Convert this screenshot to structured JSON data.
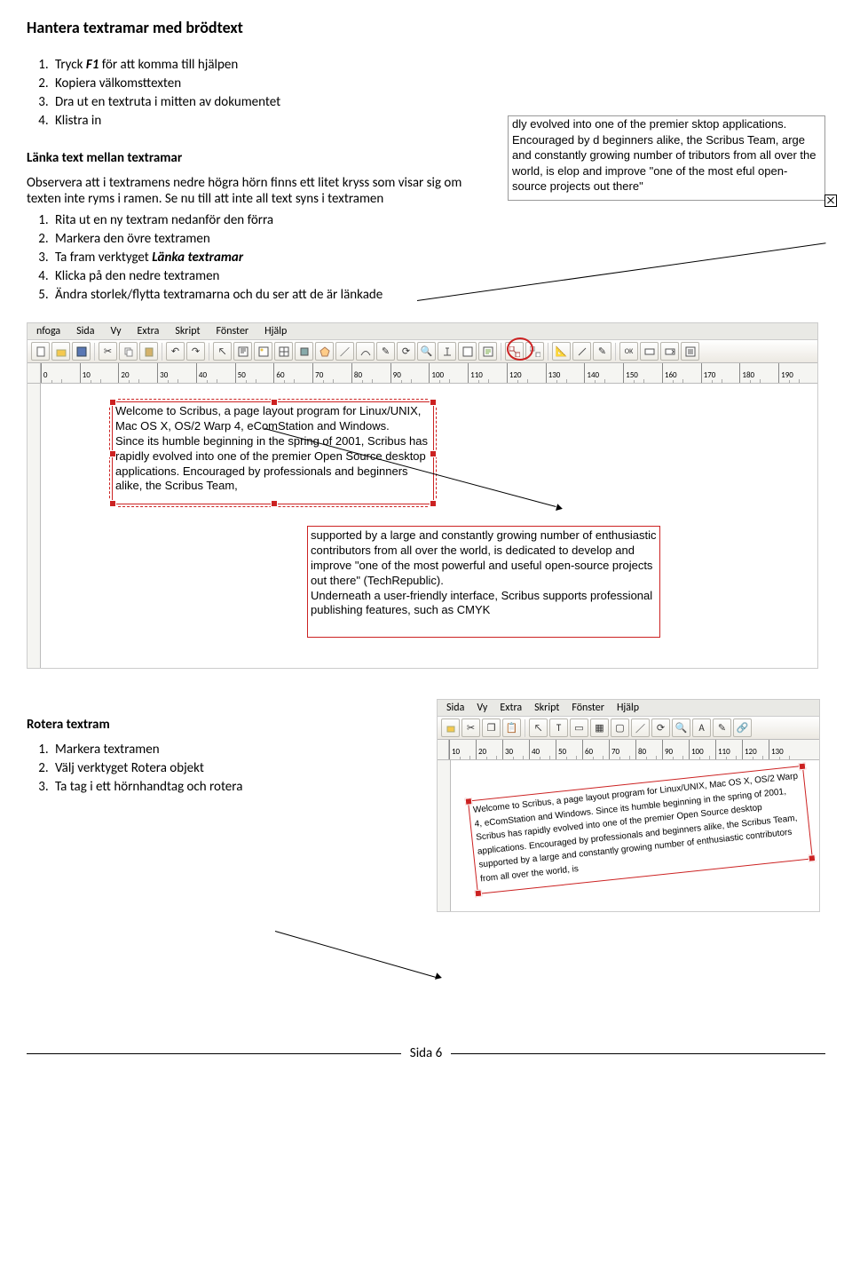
{
  "title": "Hantera textramar med brödtext",
  "section1": {
    "items": [
      {
        "pre": "Tryck ",
        "bold": "F1",
        "post": " för att komma till hjälpen"
      },
      {
        "pre": "Kopiera välkomsttexten"
      },
      {
        "pre": "Dra ut en textruta i mitten av dokumentet"
      },
      {
        "pre": "Klistra in"
      }
    ]
  },
  "link_heading": "Länka text mellan textramar",
  "link_para": "Observera att i textramens nedre högra hörn finns ett litet kryss som visar sig om texten inte ryms i ramen. Se nu till att inte all text syns i textramen",
  "overflow_text": "dly evolved into one of the premier sktop applications. Encouraged by d beginners alike, the Scribus Team, arge and constantly growing number of tributors from all over the world, is elop and improve \"one of the most eful open-source projects out there\"",
  "section2": {
    "items": [
      "Rita ut en ny textram nedanför den förra",
      "Markera den övre textramen",
      {
        "pre": "Ta fram verktyget ",
        "boldital": "Länka textramar"
      },
      "Klicka på den nedre textramen",
      "Ändra storlek/flytta textramarna och du ser att de är länkade"
    ]
  },
  "scribus1": {
    "menus": [
      "nfoga",
      "Sida",
      "Vy",
      "Extra",
      "Skript",
      "Fönster",
      "Hjälp"
    ],
    "ruler_labels": [
      "0",
      "10",
      "20",
      "30",
      "40",
      "50",
      "60",
      "70",
      "80",
      "90",
      "100",
      "110",
      "120",
      "130",
      "140",
      "150",
      "160",
      "170",
      "180",
      "190"
    ],
    "frame1_text": "Welcome to Scribus, a page layout program for Linux/UNIX, Mac OS X, OS/2 Warp 4, eComStation and Windows.\nSince its humble beginning in the spring of 2001, Scribus has rapidly evolved into one of the premier Open Source desktop applications. Encouraged by professionals and beginners alike, the Scribus Team,",
    "frame2_text": "supported by a large and constantly growing number of enthusiastic contributors from all over the world, is dedicated to develop and improve \"one of the most powerful and useful open-source projects out there\" (TechRepublic).\nUnderneath a user-friendly interface, Scribus supports professional publishing features, such as CMYK"
  },
  "rotera_heading": "Rotera textram",
  "rotera_items": [
    "Markera textramen",
    "Välj verktyget Rotera objekt",
    "Ta tag i ett hörnhandtag och rotera"
  ],
  "scribus2": {
    "menus": [
      "Sida",
      "Vy",
      "Extra",
      "Skript",
      "Fönster",
      "Hjälp"
    ],
    "ruler_labels": [
      "10",
      "20",
      "30",
      "40",
      "50",
      "60",
      "70",
      "80",
      "90",
      "100",
      "110",
      "120",
      "130"
    ],
    "rotated_text": "Welcome to Scribus, a page layout program for Linux/UNIX, Mac OS X, OS/2 Warp 4, eComStation and Windows.\nSince its humble beginning in the spring of 2001, Scribus has rapidly evolved into one of the premier Open Source desktop applications. Encouraged by professionals and beginners alike, the Scribus Team, supported by a large and constantly growing number of enthusiastic contributors from all over the world, is"
  },
  "footer_page": "Sida 6"
}
